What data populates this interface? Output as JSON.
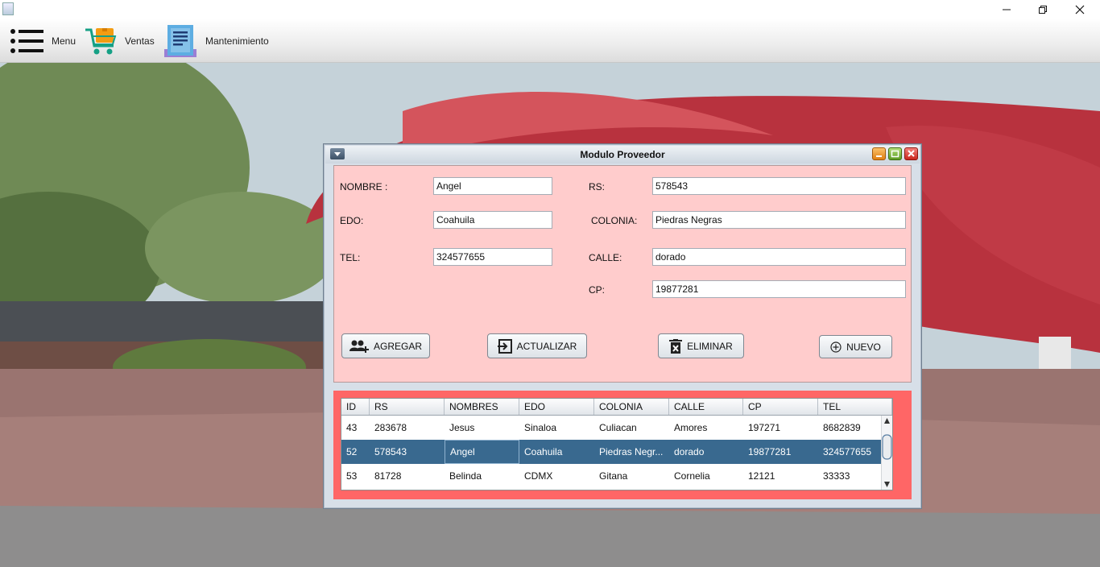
{
  "menubar": {
    "items": [
      {
        "label": "Menu",
        "icon": "hamburger-icon"
      },
      {
        "label": "Ventas",
        "icon": "shopping-cart-icon"
      },
      {
        "label": "Mantenimiento",
        "icon": "document-icon"
      }
    ]
  },
  "window_controls": {
    "minimize": "minimize-icon",
    "restore": "restore-icon",
    "close": "close-icon"
  },
  "frame": {
    "title": "Modulo Proveedor"
  },
  "form": {
    "nombre": {
      "label": "NOMBRE :",
      "value": "Angel"
    },
    "rs": {
      "label": "RS:",
      "value": "578543"
    },
    "edo": {
      "label": "EDO:",
      "value": "Coahuila"
    },
    "colonia": {
      "label": "COLONIA:",
      "value": "Piedras Negras"
    },
    "tel": {
      "label": "TEL:",
      "value": "324577655"
    },
    "calle": {
      "label": "CALLE:",
      "value": "dorado"
    },
    "cp": {
      "label": "CP:",
      "value": "19877281"
    }
  },
  "buttons": {
    "agregar": "AGREGAR",
    "actualizar": "ACTUALIZAR",
    "eliminar": "ELIMINAR",
    "nuevo": "NUEVO"
  },
  "table": {
    "columns": [
      "ID",
      "RS",
      "NOMBRES",
      "EDO",
      "COLONIA",
      "CALLE",
      "CP",
      "TEL"
    ],
    "rows": [
      [
        "43",
        "283678",
        "Jesus",
        "Sinaloa",
        "Culiacan",
        "Amores",
        "197271",
        "8682839"
      ],
      [
        "52",
        "578543",
        "Angel",
        "Coahuila",
        "Piedras Negr...",
        "dorado",
        "19877281",
        "324577655"
      ],
      [
        "53",
        "81728",
        "Belinda",
        "CDMX",
        "Gitana",
        "Cornelia",
        "12121",
        "33333"
      ]
    ],
    "selected_row": 1
  },
  "colors": {
    "form_bg": "#ffcccc",
    "table_panel_bg": "#ff6666",
    "selection": "#39698f"
  }
}
